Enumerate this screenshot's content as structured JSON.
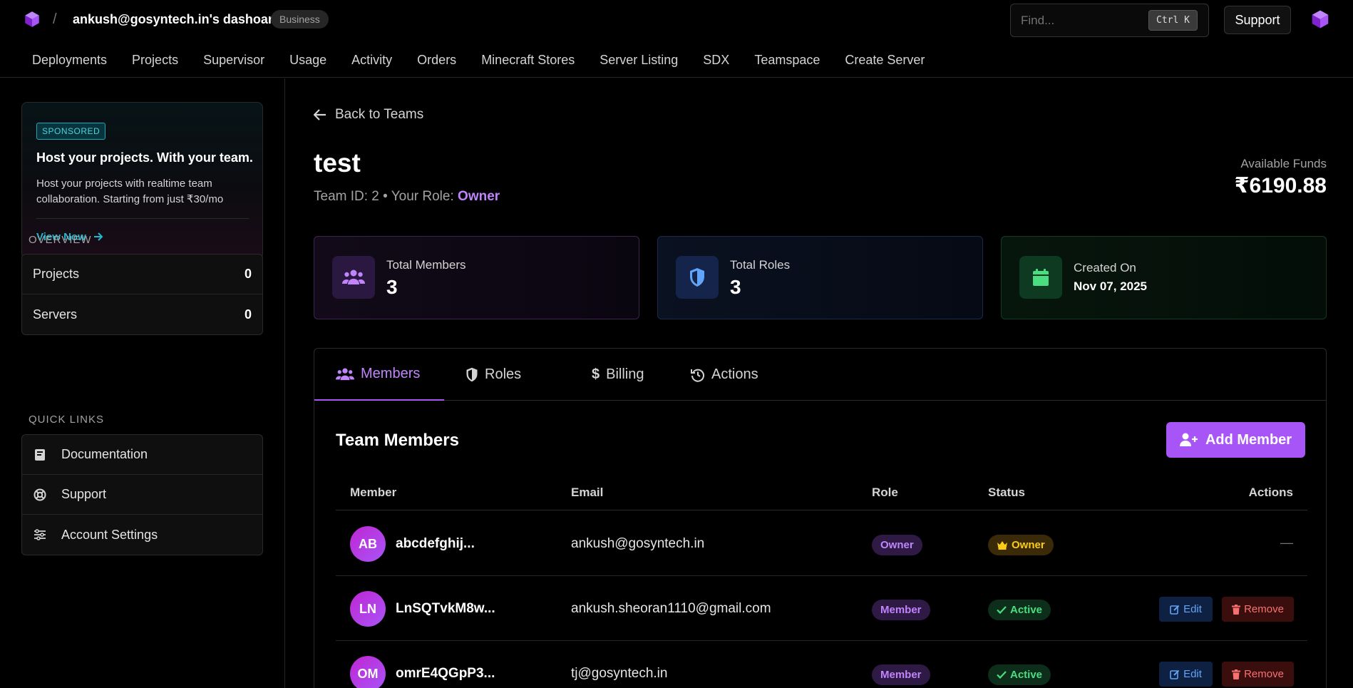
{
  "topbar": {
    "dashboard_title": "ankush@gosyntech.in's dashoard",
    "slash": "/",
    "plan_badge": "Business",
    "search_placeholder": "Find...",
    "search_shortcut": "Ctrl K",
    "support_label": "Support"
  },
  "nav": {
    "items": [
      "Deployments",
      "Projects",
      "Supervisor",
      "Usage",
      "Activity",
      "Orders",
      "Minecraft Stores",
      "Server Listing",
      "SDX",
      "Teamspace",
      "Create Server"
    ]
  },
  "sidebar": {
    "promo": {
      "badge": "SPONSORED",
      "title": "Host your projects. With your team.",
      "description": "Host your projects with realtime team collaboration. Starting from just ₹30/mo",
      "link": "View Now"
    },
    "overview_label": "OVERVIEW",
    "overview": [
      {
        "label": "Projects",
        "value": "0"
      },
      {
        "label": "Servers",
        "value": "0"
      }
    ],
    "quick_links_label": "QUICK LINKS",
    "quick_links": [
      {
        "label": "Documentation",
        "icon": "book-icon"
      },
      {
        "label": "Support",
        "icon": "lifebuoy-icon"
      },
      {
        "label": "Account Settings",
        "icon": "sliders-icon"
      }
    ]
  },
  "main": {
    "back_label": "Back to Teams",
    "team_name": "test",
    "team_meta_prefix": "Team ID: 2 • Your Role: ",
    "team_role": "Owner",
    "funds_label": "Available Funds",
    "funds_value": "₹6190.88",
    "stats": {
      "members_label": "Total Members",
      "members_value": "3",
      "roles_label": "Total Roles",
      "roles_value": "3",
      "created_label": "Created On",
      "created_value": "Nov 07, 2025"
    },
    "tabs": [
      "Members",
      "Roles",
      "Billing",
      "Actions"
    ],
    "members_title": "Team Members",
    "add_member_label": "Add Member",
    "table_headers": {
      "member": "Member",
      "email": "Email",
      "role": "Role",
      "status": "Status",
      "actions": "Actions"
    },
    "rows": [
      {
        "initials": "AB",
        "name": "abcdefghij...",
        "email": "ankush@gosyntech.in",
        "role": "Owner",
        "status": "Owner",
        "actions": "—"
      },
      {
        "initials": "LN",
        "name": "LnSQTvkM8w...",
        "email": "ankush.sheoran1110@gmail.com",
        "role": "Member",
        "status": "Active",
        "edit": "Edit",
        "remove": "Remove"
      },
      {
        "initials": "OM",
        "name": "omrE4QGpP3...",
        "email": "tj@gosyntech.in",
        "role": "Member",
        "status": "Active",
        "edit": "Edit",
        "remove": "Remove"
      }
    ]
  },
  "colors": {
    "accent": "#a855f7",
    "accent_text": "#c084fc",
    "link_cyan": "#22b8cf",
    "active_green": "#4ade80",
    "owner_gold": "#facc15",
    "edit_blue": "#60a5fa",
    "remove_red": "#f87171"
  }
}
